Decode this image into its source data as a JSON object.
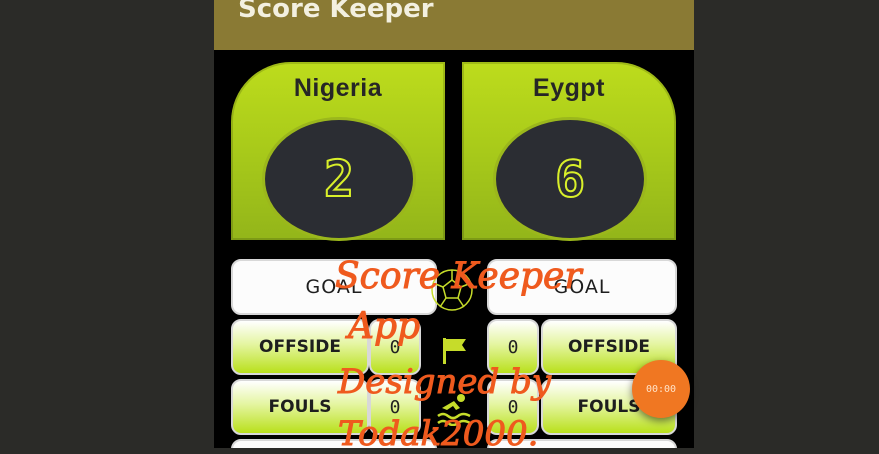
{
  "app": {
    "title": "Score Keeper"
  },
  "teams": [
    {
      "name": "Nigeria",
      "score": "2"
    },
    {
      "name": "Eygpt",
      "score": "6"
    }
  ],
  "left_controls": {
    "goal_label": "GOAL",
    "offside_label": "OFFSIDE",
    "offside_count": "0",
    "fouls_label": "FOULS",
    "fouls_count": "0"
  },
  "right_controls": {
    "goal_label": "GOAL",
    "offside_label": "OFFSIDE",
    "offside_count": "0",
    "fouls_label": "FOULS",
    "fouls_count": "0"
  },
  "overlay": {
    "line1": "Score Keeper",
    "line2": "App",
    "line3": "Designed by",
    "line4": "Todak2000."
  },
  "fab": {
    "label": "00:00"
  },
  "icons": [
    "soccer-ball-icon",
    "flag-icon",
    "swimmer-icon"
  ],
  "colors": {
    "accent": "#bddc1c",
    "appbar": "#8a7a34",
    "overlay_text": "#ef5a1e",
    "fab": "#f07722"
  }
}
